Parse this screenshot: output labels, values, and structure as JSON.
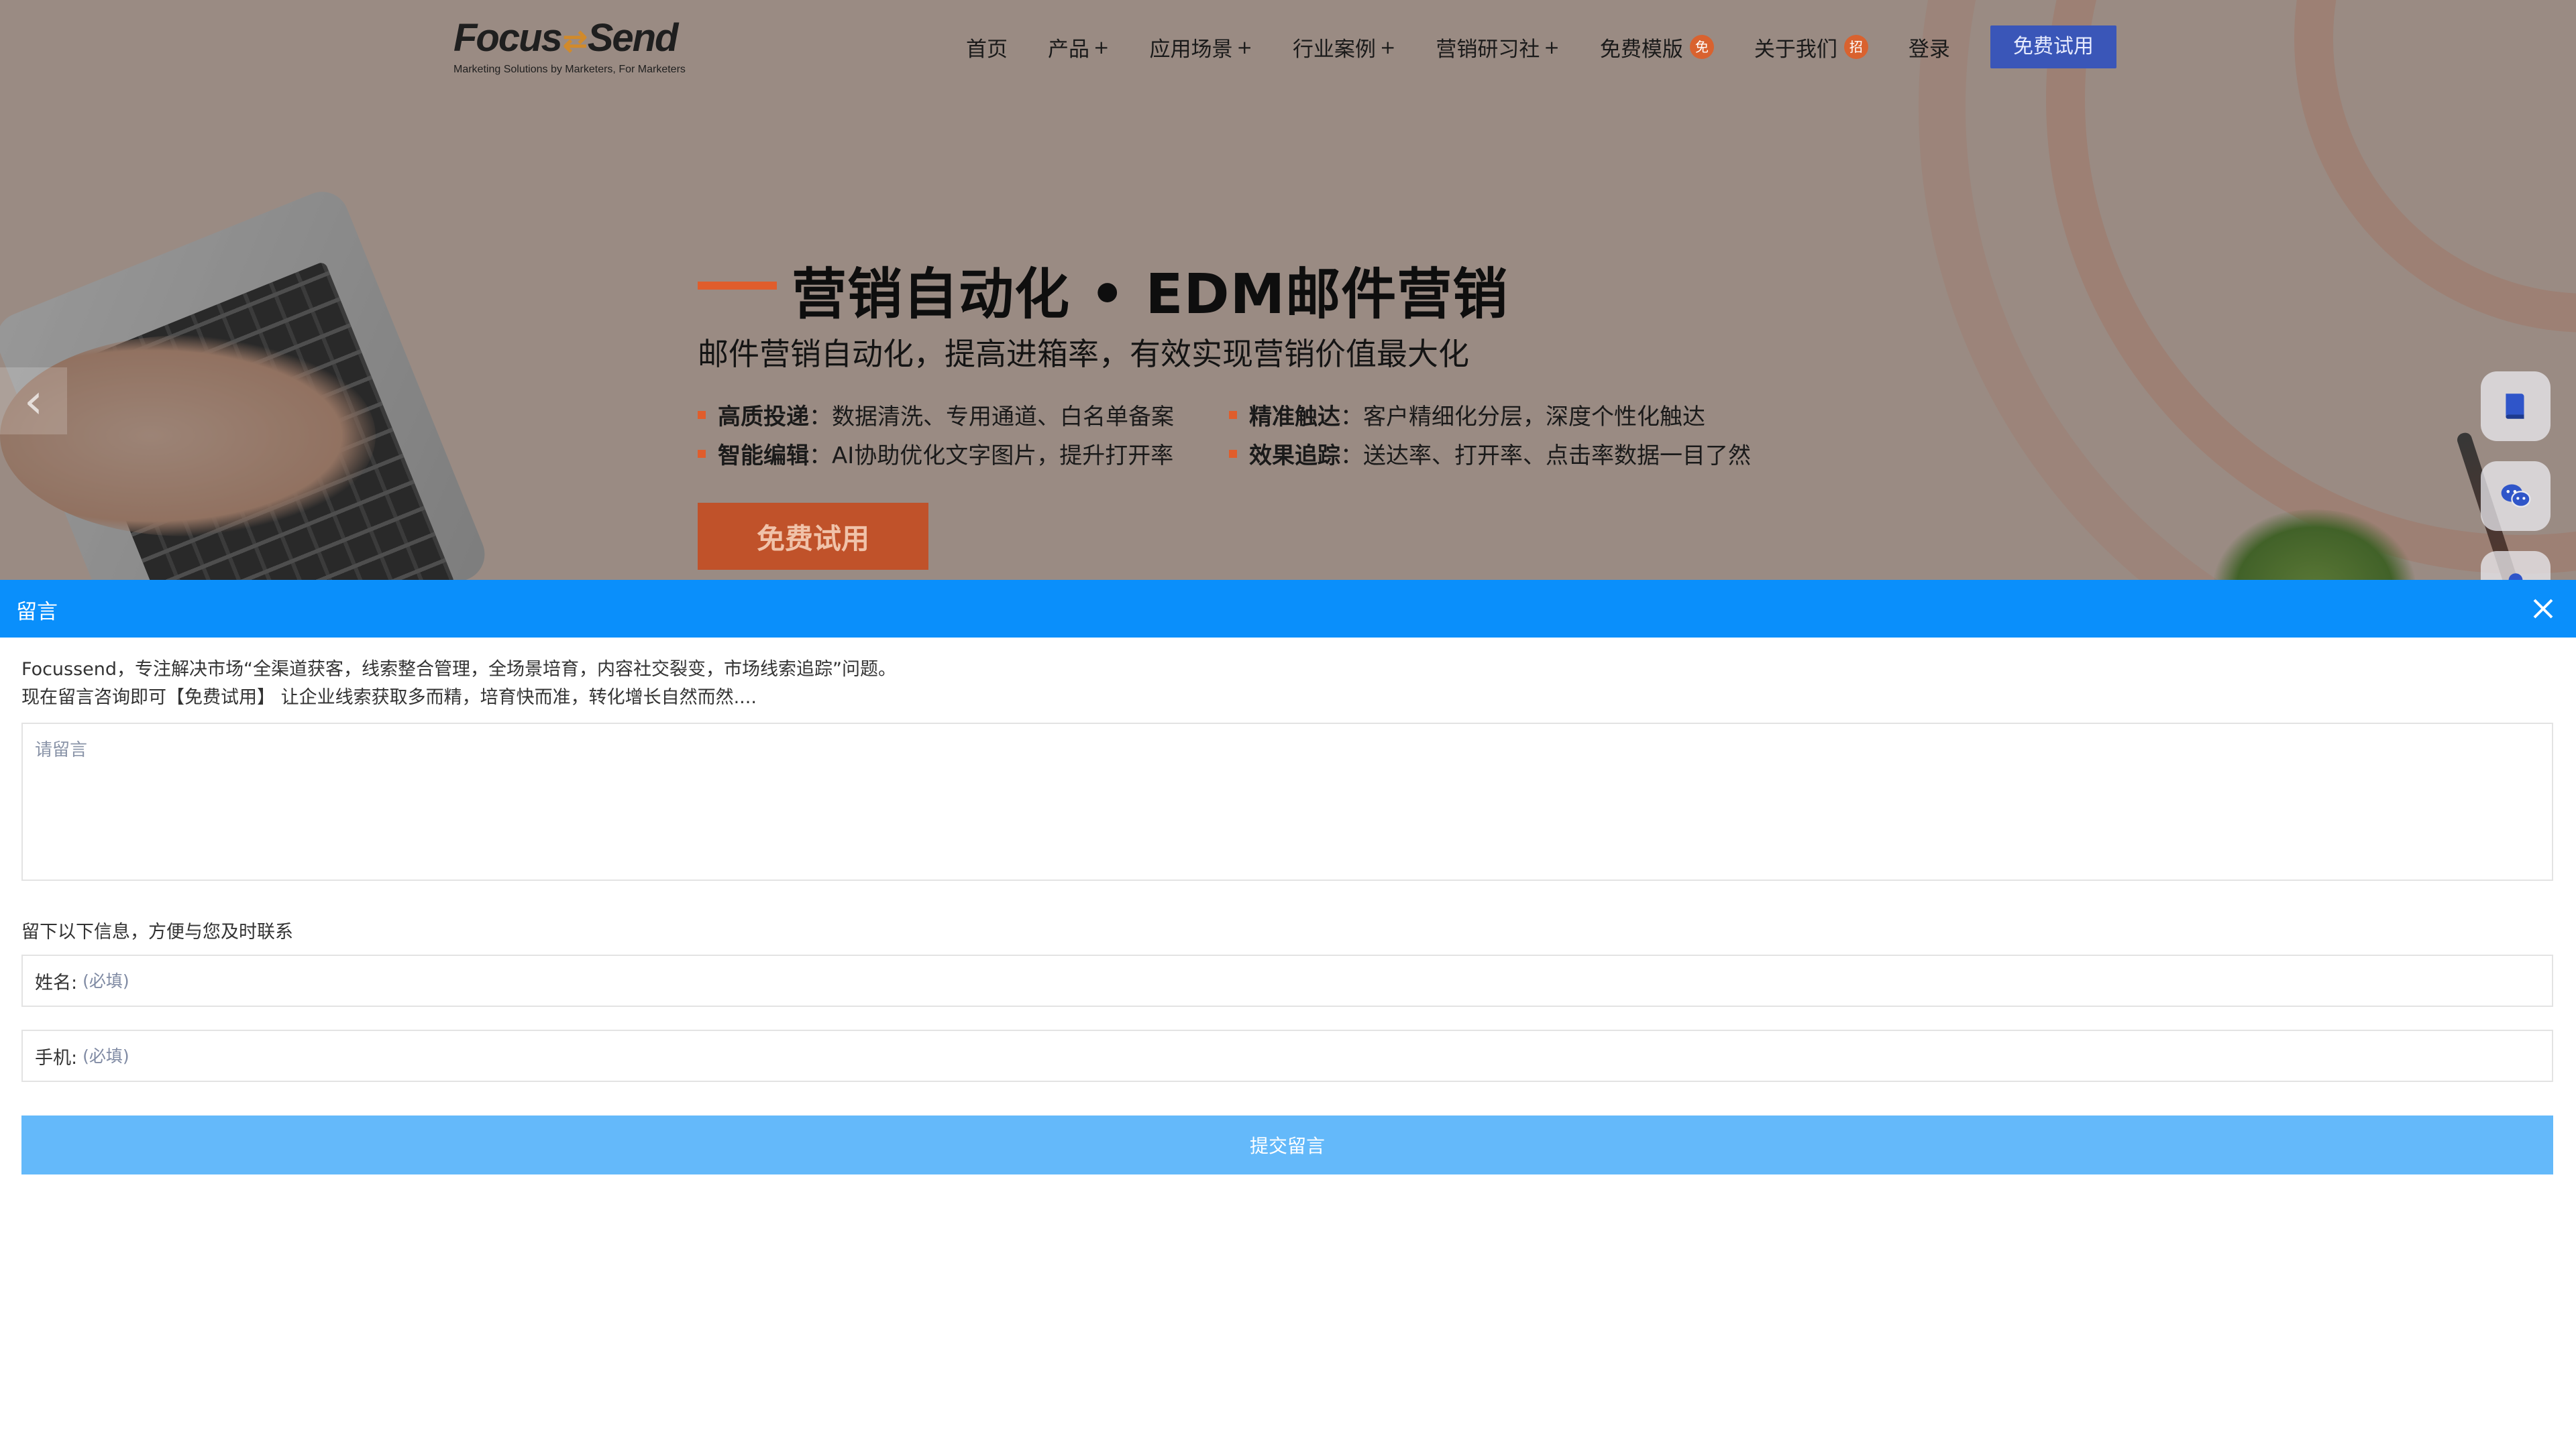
{
  "header": {
    "logo_text_left": "Focus",
    "logo_text_right": "Send",
    "logo_tagline": "Marketing Solutions by Marketers, For Marketers",
    "nav": [
      {
        "label": "首页",
        "has_plus": false
      },
      {
        "label": "产品",
        "has_plus": true
      },
      {
        "label": "应用场景",
        "has_plus": true
      },
      {
        "label": "行业案例",
        "has_plus": true
      },
      {
        "label": "营销研习社",
        "has_plus": true
      },
      {
        "label": "免费模版",
        "badge": "免"
      },
      {
        "label": "关于我们",
        "badge": "招"
      },
      {
        "label": "登录"
      }
    ],
    "cta_label": "免费试用",
    "colors": {
      "cta_bg": "#3a56b8",
      "badge_bg": "#d9622f"
    }
  },
  "hero": {
    "title": "营销自动化 • EDM邮件营销",
    "subtitle": "邮件营销自动化，提高进箱率，有效实现营销价值最大化",
    "features": [
      {
        "bold": "高质投递",
        "text": "：数据清洗、专用通道、白名单备案"
      },
      {
        "bold": "精准触达",
        "text": "：客户精细化分层，深度个性化触达"
      },
      {
        "bold": "智能编辑",
        "text": "：AI协助优化文字图片，提升打开率"
      },
      {
        "bold": "效果追踪",
        "text": "：送达率、打开率、点击率数据一目了然"
      }
    ],
    "cta_label": "免费试用",
    "accent_color": "#e05d2c",
    "left_arrow": "‹"
  },
  "floating": [
    {
      "icon": "book-icon"
    },
    {
      "icon": "wechat-icon"
    },
    {
      "icon": "user-icon"
    }
  ],
  "message_panel": {
    "title": "留言",
    "intro_line1": "Focussend，专注解决市场“全渠道获客，线索整合管理，全场景培育，内容社交裂变，市场线索追踪”问题。",
    "intro_line2": "现在留言咨询即可【免费试用】 让企业线索获取多而精，培育快而准，转化增长自然而然....",
    "textarea_placeholder": "请留言",
    "contact_label": "留下以下信息，方便与您及时联系",
    "fields": [
      {
        "label": "姓名:",
        "placeholder": "(必填)"
      },
      {
        "label": "手机:",
        "placeholder": "(必填)"
      }
    ],
    "submit_label": "提交留言",
    "colors": {
      "header_bg": "#0a8ffb",
      "submit_bg": "#64b9fa"
    }
  }
}
